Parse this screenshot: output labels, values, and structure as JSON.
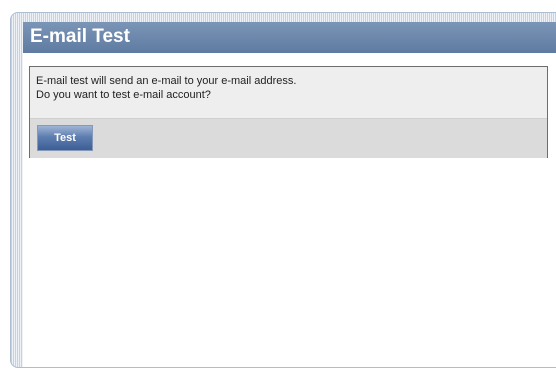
{
  "page": {
    "title": "E-mail Test",
    "message_line1": "E-mail test will send an e-mail to your e-mail address.",
    "message_line2": "Do you want to test e-mail account?",
    "test_button_label": "Test"
  },
  "colors": {
    "header": "#6a86ac",
    "button": "#4c6ca4",
    "panel_background": "#eeeeee"
  }
}
